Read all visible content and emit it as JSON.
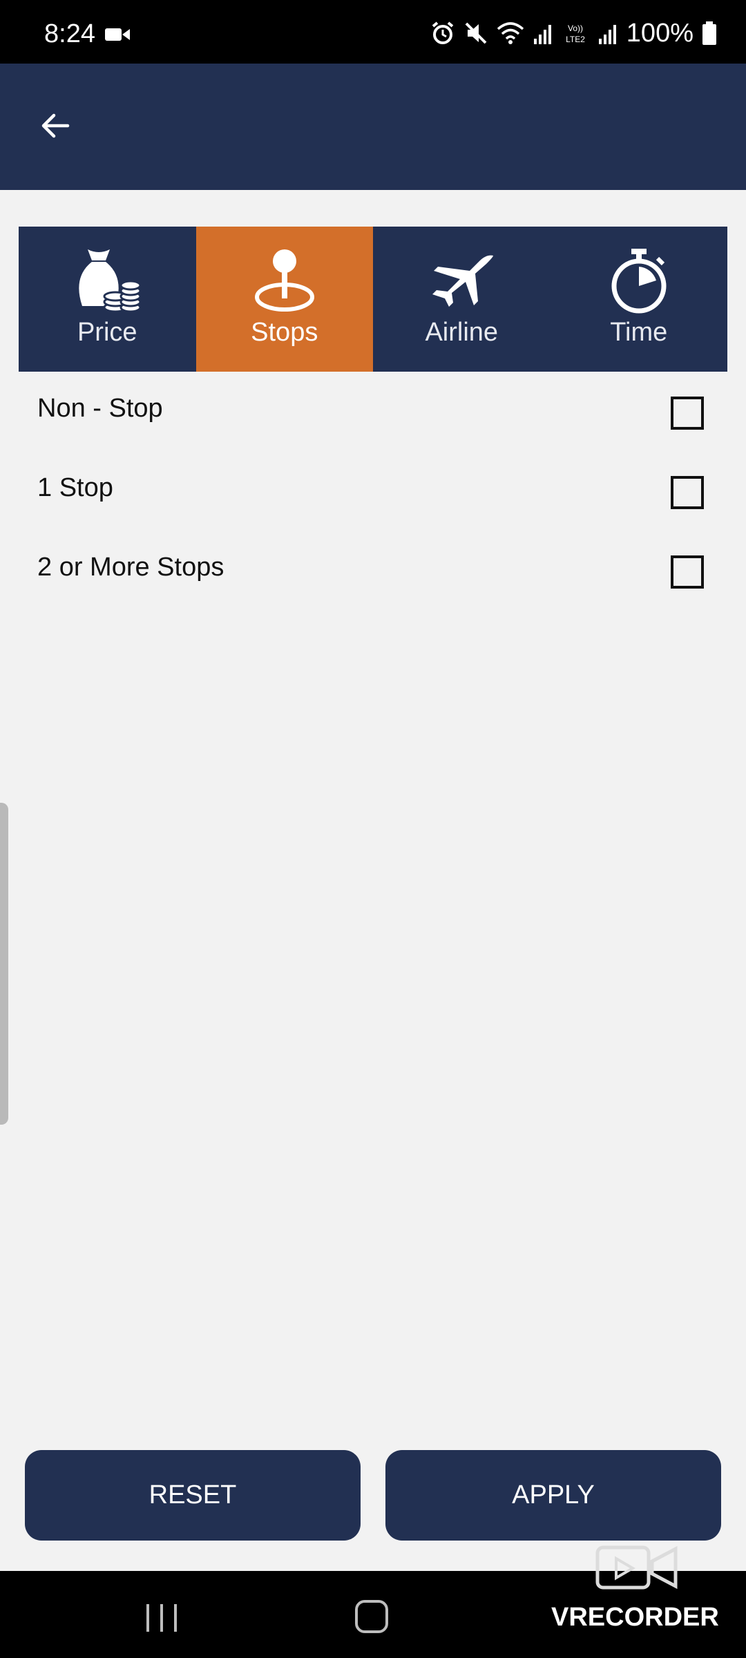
{
  "status_bar": {
    "time": "8:24",
    "battery": "100%",
    "icons": [
      "video-camera-icon",
      "alarm-icon",
      "mute-icon",
      "wifi-icon",
      "signal-icon",
      "volte-icon",
      "signal-icon",
      "battery-icon"
    ]
  },
  "app_bar": {
    "back_icon": "arrow-left-icon",
    "background": "#223052"
  },
  "tabs": [
    {
      "label": "Price",
      "icon": "money-bag-coins-icon",
      "active": false
    },
    {
      "label": "Stops",
      "icon": "location-pin-icon",
      "active": true
    },
    {
      "label": "Airline",
      "icon": "airplane-icon",
      "active": false
    },
    {
      "label": "Time",
      "icon": "stopwatch-icon",
      "active": false
    }
  ],
  "options": [
    {
      "label": "Non - Stop",
      "checked": false
    },
    {
      "label": "1 Stop",
      "checked": false
    },
    {
      "label": "2 or More Stops",
      "checked": false
    }
  ],
  "buttons": {
    "reset": "RESET",
    "apply": "APPLY"
  },
  "watermark": "VRECORDER",
  "colors": {
    "primary": "#223052",
    "accent": "#d36f2a",
    "background": "#f2f2f2"
  }
}
